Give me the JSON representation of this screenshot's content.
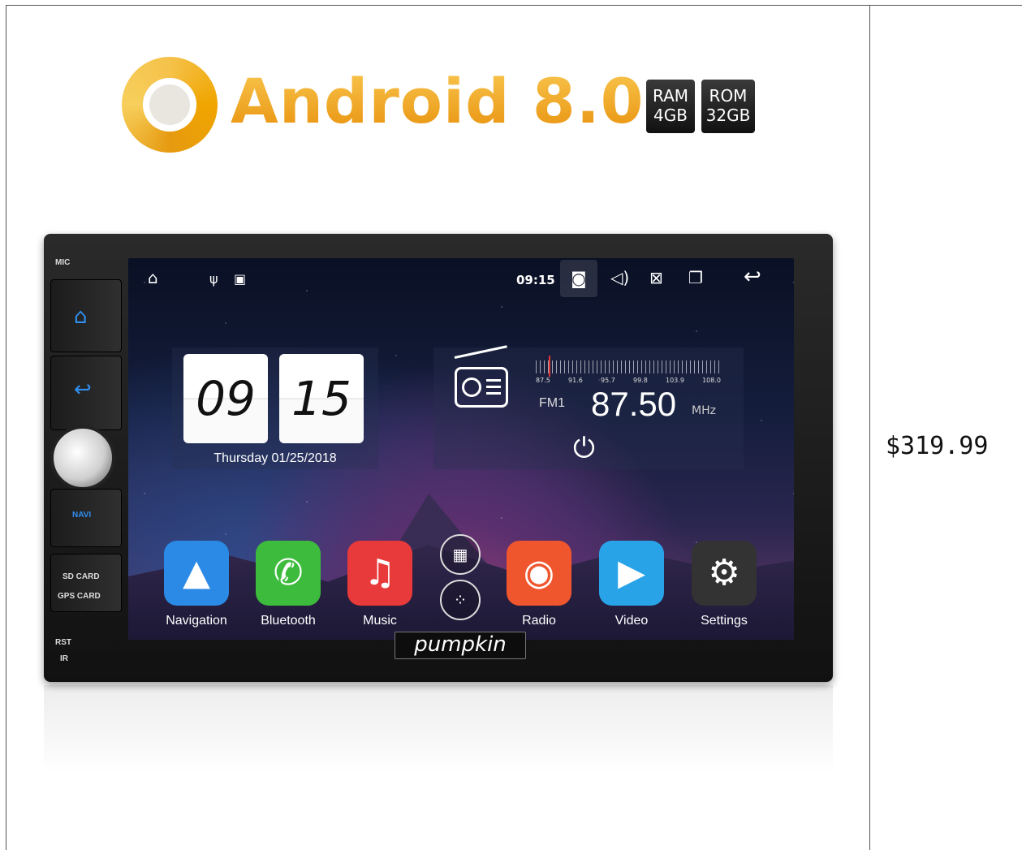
{
  "price": "$319.99",
  "banner": {
    "os_label": "Android 8.0",
    "ram_label": "RAM",
    "ram_value": "4GB",
    "rom_label": "ROM",
    "rom_value": "32GB"
  },
  "device": {
    "side_labels": {
      "mic": "MIC",
      "navi": "NAVI",
      "sd_card": "SD CARD",
      "gps_card": "GPS CARD",
      "rst": "RST",
      "ir": "IR"
    },
    "brand": "pumpkin",
    "status_bar": {
      "time": "09:15",
      "icons": [
        "home-icon",
        "usb-icon",
        "image-icon",
        "camera-icon",
        "volume-icon",
        "close-icon",
        "recent-apps-icon",
        "back-icon"
      ]
    },
    "clock_widget": {
      "hour": "09",
      "minute": "15",
      "date": "Thursday 01/25/2018"
    },
    "radio_widget": {
      "band": "FM1",
      "frequency": "87.50",
      "unit": "MHz",
      "scale": [
        "87.5",
        "91.6",
        "95.7",
        "99.8",
        "103.9",
        "108.0"
      ]
    },
    "apps": [
      {
        "name": "Navigation",
        "icon": "navigation-icon",
        "color": "#2a8ae6"
      },
      {
        "name": "Bluetooth",
        "icon": "phone-icon",
        "color": "#3dbb3d"
      },
      {
        "name": "Music",
        "icon": "music-note-icon",
        "color": "#e83a3a"
      },
      {
        "name": "Radio",
        "icon": "radio-wave-icon",
        "color": "#f0562e"
      },
      {
        "name": "Video",
        "icon": "play-icon",
        "color": "#29a3e8"
      },
      {
        "name": "Settings",
        "icon": "gear-icon",
        "color": "#333333"
      }
    ]
  }
}
